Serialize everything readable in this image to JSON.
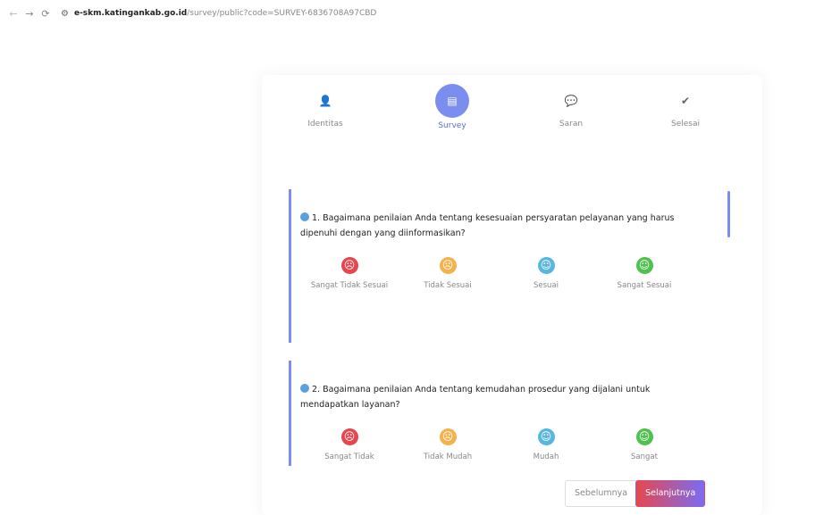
{
  "browser": {
    "url_host": "e-skm.katingankab.go.id",
    "url_path": "/survey/public?code=SURVEY-6836708A97CBD"
  },
  "steps": [
    {
      "label": "Identitas",
      "icon": "user-icon"
    },
    {
      "label": "Survey",
      "icon": "survey-icon"
    },
    {
      "label": "Saran",
      "icon": "chat-icon"
    },
    {
      "label": "Selesai",
      "icon": "check-circle-icon"
    }
  ],
  "questions": [
    {
      "number": "1.",
      "text": "Bagaimana penilaian Anda tentang kesesuaian persyaratan pelayanan yang harus dipenuhi dengan yang diinformasikan?",
      "options": [
        "Sangat Tidak Sesuai",
        "Tidak Sesuai",
        "Sesuai",
        "Sangat Sesuai"
      ]
    },
    {
      "number": "2.",
      "text": "Bagaimana penilaian Anda tentang kemudahan prosedur yang dijalani untuk mendapatkan layanan?",
      "options": [
        "Sangat Tidak",
        "Tidak Mudah",
        "Mudah",
        "Sangat"
      ]
    }
  ],
  "buttons": {
    "prev": "Sebelumnya",
    "next": "Selanjutnya"
  },
  "colors": {
    "accent": "#7b8ef0",
    "red": "#e6474f",
    "orange": "#f5b24a",
    "blue": "#59b6df",
    "green": "#4fc24d"
  }
}
